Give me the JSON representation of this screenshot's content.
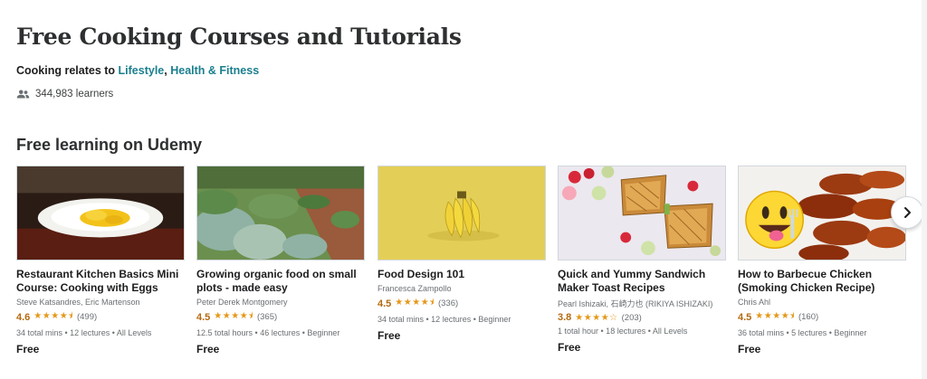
{
  "page": {
    "title": "Free Cooking Courses and Tutorials",
    "relates_prefix": "Cooking relates to",
    "relates_link_1": "Lifestyle",
    "relates_sep": ",",
    "relates_link_2": "Health & Fitness",
    "learners": "344,983 learners",
    "section_title": "Free learning on Udemy"
  },
  "courses": [
    {
      "title": "Restaurant Kitchen Basics Mini Course: Cooking with Eggs",
      "author": "Steve Katsandres, Eric Martenson",
      "rating": "4.6",
      "stars": "★★★★⯨",
      "count": "(499)",
      "meta": "34 total mins • 12 lectures • All Levels",
      "price": "Free",
      "image": "eggs-plate"
    },
    {
      "title": "Growing organic food on small plots - made easy",
      "author": "Peter Derek Montgomery",
      "rating": "4.5",
      "stars": "★★★★⯨",
      "count": "(365)",
      "meta": "12.5 total hours • 46 lectures • Beginner",
      "price": "Free",
      "image": "vegetable-garden"
    },
    {
      "title": "Food Design 101",
      "author": "Francesca Zampollo",
      "rating": "4.5",
      "stars": "★★★★⯨",
      "count": "(336)",
      "meta": "34 total mins • 12 lectures • Beginner",
      "price": "Free",
      "image": "bananas"
    },
    {
      "title": "Quick and Yummy Sandwich Maker Toast Recipes",
      "author": "Pearl Ishizaki, 石崎力也 (RIKIYA ISHIZAKI)",
      "rating": "3.8",
      "stars": "★★★★☆",
      "count": "(203)",
      "meta": "1 total hour • 18 lectures • All Levels",
      "price": "Free",
      "image": "toast-sandwiches"
    },
    {
      "title": "How to Barbecue Chicken (Smoking Chicken Recipe)",
      "author": "Chris Ahl",
      "rating": "4.5",
      "stars": "★★★★⯨",
      "count": "(160)",
      "meta": "36 total mins • 5 lectures • Beginner",
      "price": "Free",
      "image": "bbq-chicken-emoji"
    }
  ],
  "icons": {
    "learners": "people-icon",
    "next": "chevron-right-icon"
  },
  "colors": {
    "link": "#1a7f8e",
    "rating": "#b4690e",
    "stars": "#e59819"
  }
}
